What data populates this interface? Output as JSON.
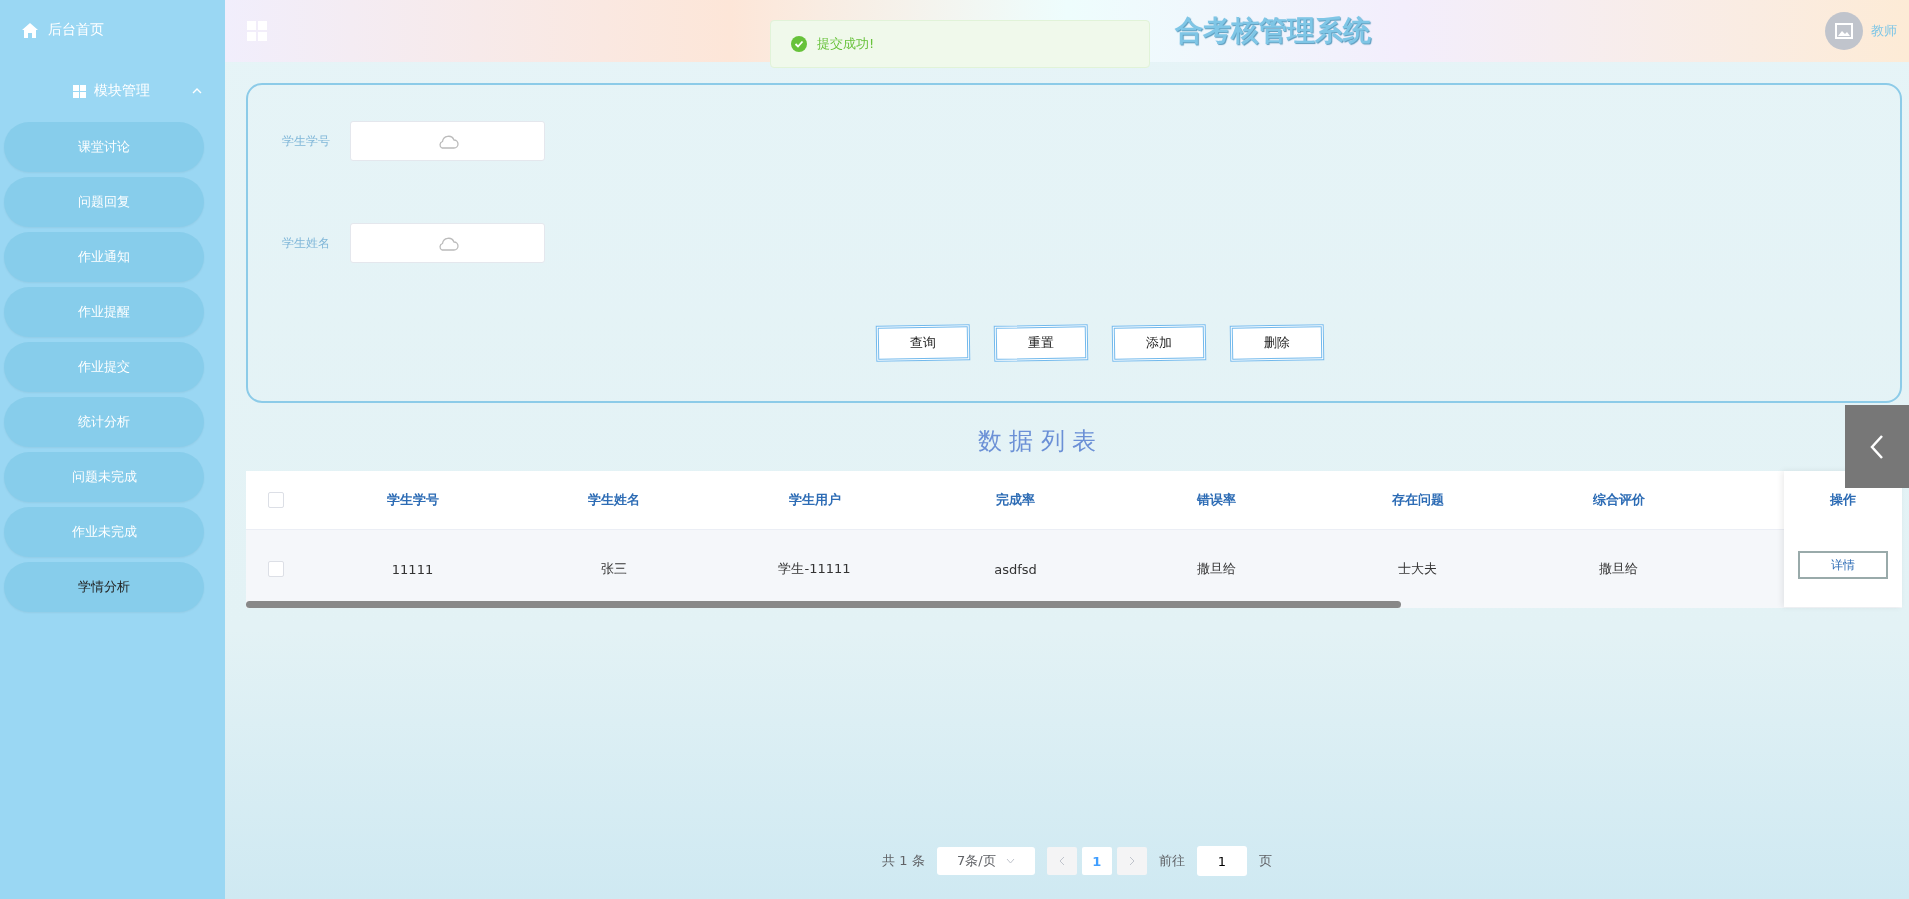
{
  "sidebar": {
    "home": {
      "label": "后台首页"
    },
    "group": {
      "label": "模块管理",
      "expanded": true
    },
    "items": [
      {
        "label": "课堂讨论",
        "selected": false
      },
      {
        "label": "问题回复",
        "selected": false
      },
      {
        "label": "作业通知",
        "selected": false
      },
      {
        "label": "作业提醒",
        "selected": false
      },
      {
        "label": "作业提交",
        "selected": false
      },
      {
        "label": "统计分析",
        "selected": false
      },
      {
        "label": "问题未完成",
        "selected": false
      },
      {
        "label": "作业未完成",
        "selected": false
      },
      {
        "label": "学情分析",
        "selected": true
      }
    ]
  },
  "header": {
    "title": "合考核管理系统",
    "user": "教师"
  },
  "toast": {
    "message": "提交成功!"
  },
  "search": {
    "fields": [
      {
        "label": "学生学号"
      },
      {
        "label": "学生姓名"
      }
    ],
    "buttons": [
      "查询",
      "重置",
      "添加",
      "删除"
    ]
  },
  "list_title": "数 据 列 表",
  "table": {
    "columns": [
      "学生学号",
      "学生姓名",
      "学生用户",
      "完成率",
      "错误率",
      "存在问题",
      "综合评价"
    ],
    "action_column": "操作",
    "select_all_checked": false,
    "rows": [
      {
        "checked": false,
        "cells": [
          "11111",
          "张三",
          "学生-11111",
          "asdfsd",
          "撒旦给",
          "士大夫",
          "撒旦给"
        ],
        "action": "详情"
      }
    ]
  },
  "pagination": {
    "total": "共 1 条",
    "page_size": "7条/页",
    "pages": [
      {
        "label": "1",
        "selected": true
      }
    ],
    "goto_label": "前往",
    "goto_value": "1",
    "goto_suffix": "页"
  }
}
